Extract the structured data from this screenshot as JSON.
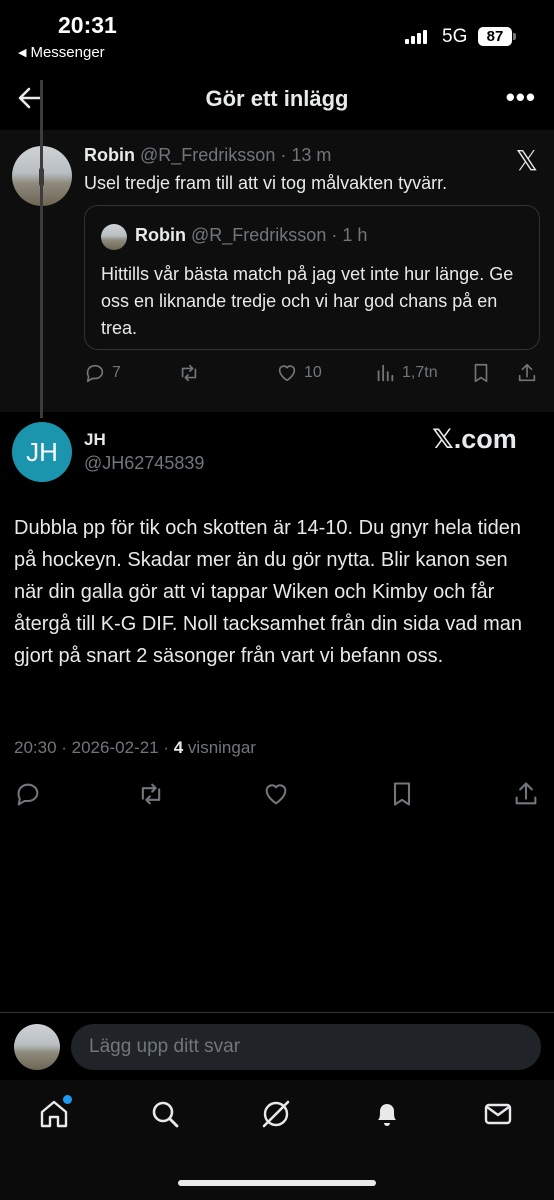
{
  "status_bar": {
    "time": "20:31",
    "back_app": "Messenger",
    "network": "5G",
    "battery": "87"
  },
  "header": {
    "title": "Gör ett inlägg",
    "more": "•••"
  },
  "original_post": {
    "author_name": "Robin",
    "author_handle": "@R_Fredriksson",
    "time": "· 13 m",
    "text": "Usel tredje fram till att vi tog målvakten tyvärr.",
    "x_logo": "𝕏",
    "quote": {
      "author_name": "Robin",
      "author_handle": "@R_Fredriksson",
      "time": "· 1 h",
      "text": "Hittills vår bästa match på jag vet inte hur länge. Ge oss en liknande tredje och vi har god chans på en trea."
    },
    "actions": {
      "replies": "7",
      "likes": "10",
      "views": "1,7tn"
    }
  },
  "reply": {
    "avatar_initials": "JH",
    "author_name": "JH",
    "author_handle": "@JH62745839",
    "source": "𝕏.com",
    "text": "Dubbla pp för tik och skotten är 14-10. Du gnyr hela tiden på hockeyn. Skadar mer än du gör nytta. Blir kanon sen när din galla gör att vi tappar Wiken och Kimby och får återgå till K-G DIF. Noll tacksamhet från din sida vad man gjort på snart 2 säsonger från vart vi befann oss.",
    "timestamp": "20:30 · 2026-02-21 · ",
    "views_count": "4",
    "views_label": " visningar"
  },
  "composer": {
    "placeholder": "Lägg upp ditt svar"
  },
  "colors": {
    "background": "#000000",
    "text": "#e7e9ea",
    "muted": "#71767b",
    "accent": "#1d9bf0",
    "avatar_jh": "#1b95ad"
  },
  "icons": {
    "bottom_nav": [
      "home-icon",
      "search-icon",
      "grok-icon",
      "notifications-icon",
      "messages-icon"
    ]
  }
}
